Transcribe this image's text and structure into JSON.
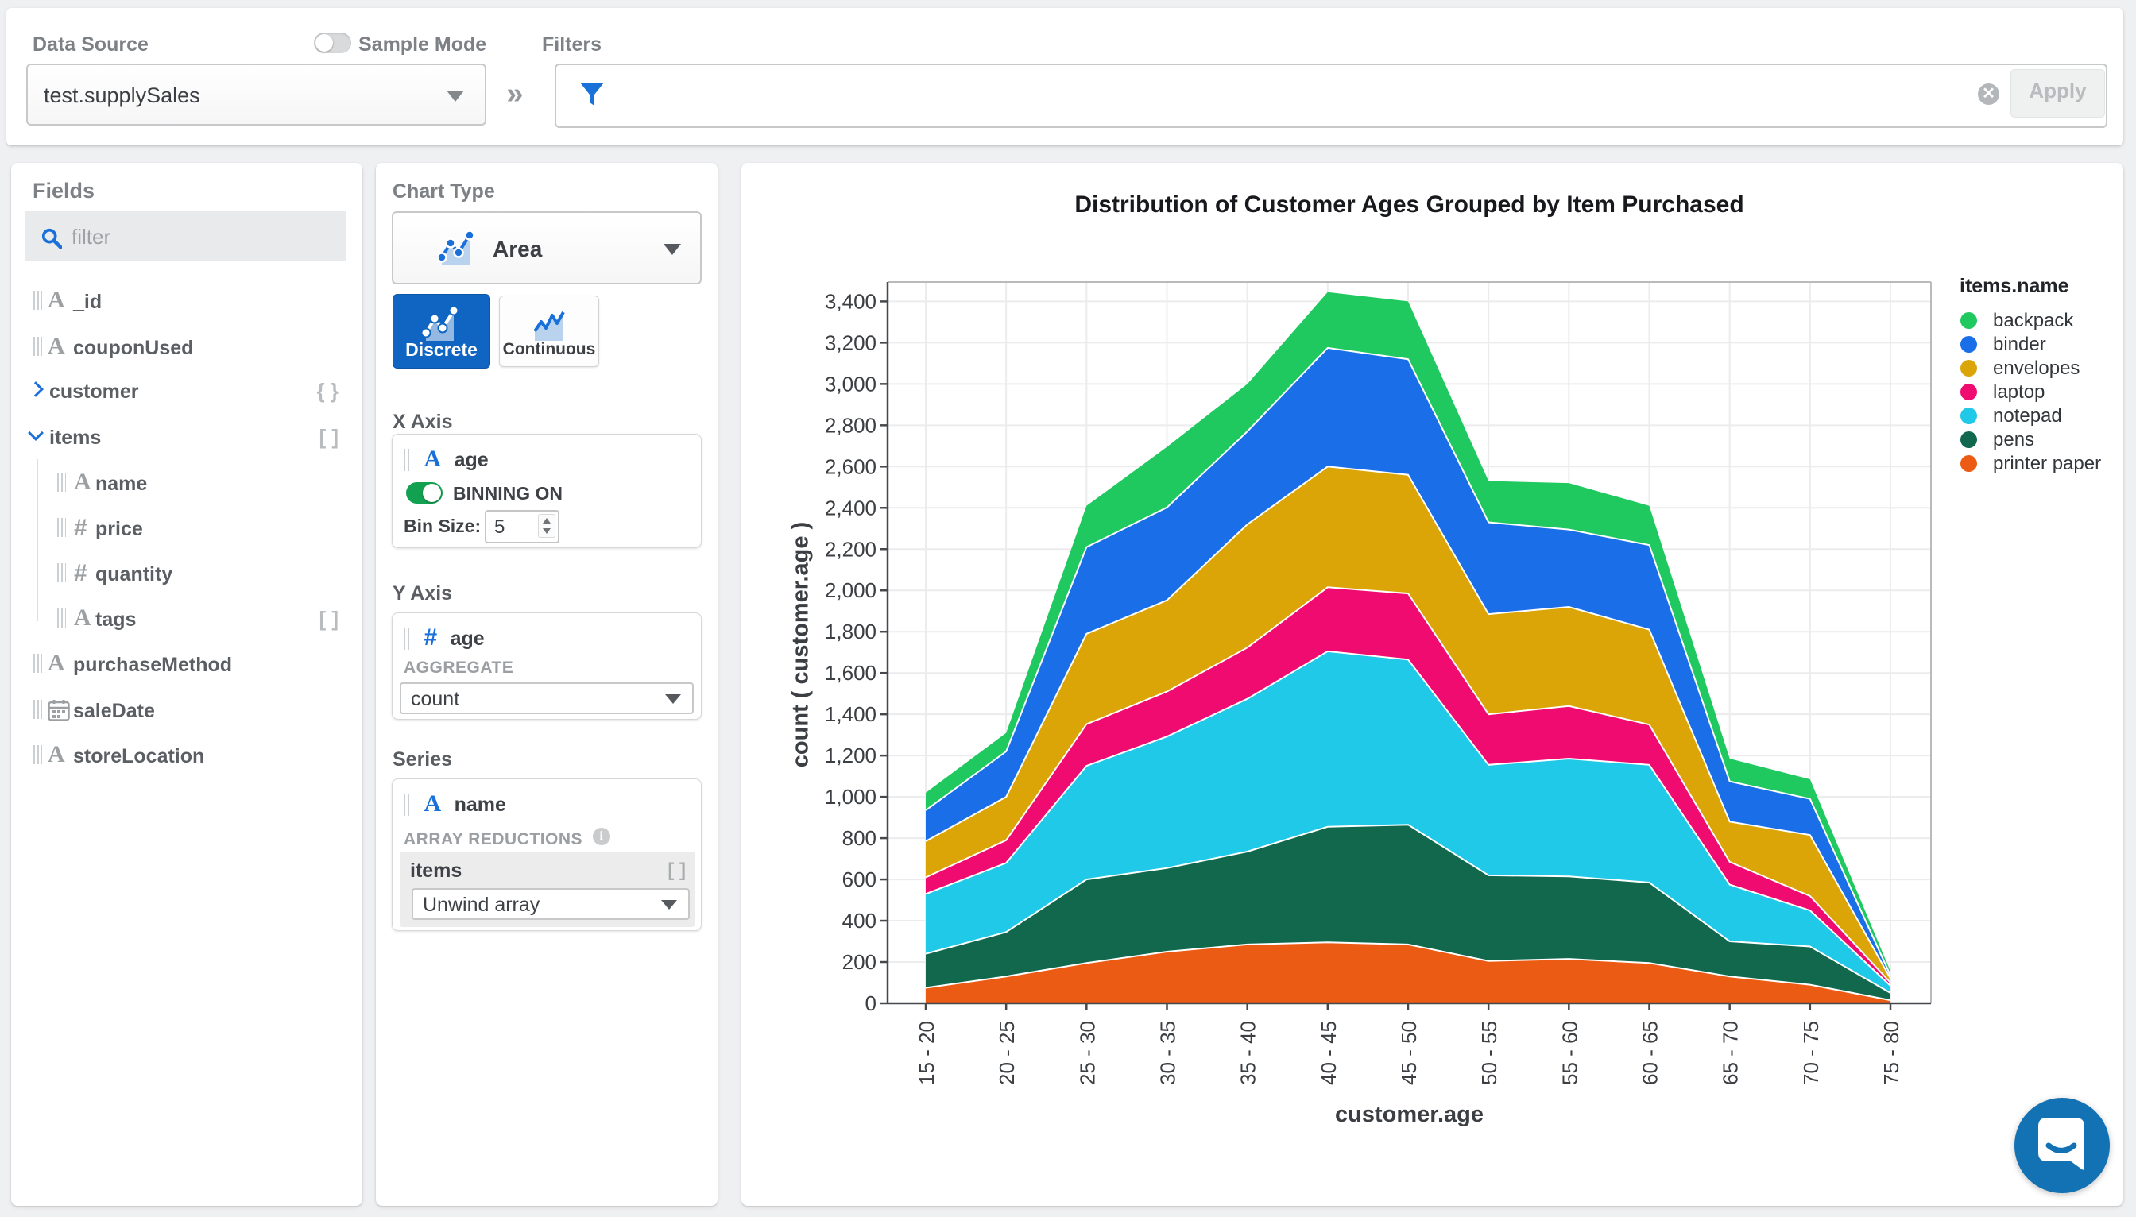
{
  "topbar": {
    "data_source_label": "Data Source",
    "data_source_value": "test.supplySales",
    "sample_mode_label": "Sample Mode",
    "filters_label": "Filters",
    "collapse_icon": "»",
    "clear_icon": "✕",
    "apply_label": "Apply"
  },
  "fields": {
    "title": "Fields",
    "filter_placeholder": "filter",
    "items": [
      {
        "label": "_id",
        "type": "string",
        "level": 0
      },
      {
        "label": "couponUsed",
        "type": "string",
        "level": 0
      },
      {
        "label": "customer",
        "type": "object",
        "level": 0,
        "expandable": true,
        "expanded": false,
        "badge": "{ }"
      },
      {
        "label": "items",
        "type": "array",
        "level": 0,
        "expandable": true,
        "expanded": true,
        "badge": "[ ]"
      },
      {
        "label": "name",
        "type": "string",
        "level": 1
      },
      {
        "label": "price",
        "type": "number",
        "level": 1
      },
      {
        "label": "quantity",
        "type": "number",
        "level": 1
      },
      {
        "label": "tags",
        "type": "string",
        "level": 1,
        "badge": "[ ]"
      },
      {
        "label": "purchaseMethod",
        "type": "string",
        "level": 0
      },
      {
        "label": "saleDate",
        "type": "date",
        "level": 0
      },
      {
        "label": "storeLocation",
        "type": "string",
        "level": 0
      }
    ]
  },
  "chart_type": {
    "label": "Chart Type",
    "selected": "Area",
    "discrete_label": "Discrete",
    "continuous_label": "Continuous",
    "discrete_selected": true
  },
  "encoding": {
    "x_axis_label": "X Axis",
    "x_field": "age",
    "x_field_type": "string",
    "binning_label": "BINNING ON",
    "binning_on": true,
    "bin_size_label": "Bin Size:",
    "bin_size_value": "5",
    "y_axis_label": "Y Axis",
    "y_field": "age",
    "y_field_type": "number",
    "aggregate_label": "AGGREGATE",
    "aggregate_value": "count",
    "series_label": "Series",
    "series_field": "name",
    "series_field_type": "string",
    "array_reductions_label": "ARRAY REDUCTIONS",
    "reduction_field": "items",
    "reduction_badge": "[ ]",
    "reduction_value": "Unwind array"
  },
  "chart_data": {
    "type": "area",
    "variant": "stacked-discrete",
    "title": "Distribution of Customer Ages Grouped by Item Purchased",
    "xlabel": "customer.age",
    "ylabel": "count ( customer.age )",
    "legend_title": "items.name",
    "legend_position": "right",
    "grid": true,
    "ylim": [
      0,
      3400
    ],
    "ytick_step": 200,
    "categories": [
      "15 - 20",
      "20 - 25",
      "25 - 30",
      "30 - 35",
      "35 - 40",
      "40 - 45",
      "45 - 50",
      "50 - 55",
      "55 - 60",
      "60 - 65",
      "65 - 70",
      "70 - 75",
      "75 - 80"
    ],
    "series": [
      {
        "name": "backpack",
        "color": "#20c95f",
        "values": [
          85,
          90,
          200,
          293,
          230,
          270,
          280,
          200,
          225,
          190,
          110,
          95,
          20
        ]
      },
      {
        "name": "binder",
        "color": "#1a6fe8",
        "values": [
          150,
          220,
          420,
          450,
          450,
          575,
          560,
          445,
          375,
          410,
          195,
          175,
          15
        ]
      },
      {
        "name": "envelopes",
        "color": "#dba508",
        "values": [
          175,
          210,
          438,
          442,
          597,
          585,
          575,
          485,
          480,
          460,
          195,
          295,
          20
        ]
      },
      {
        "name": "laptop",
        "color": "#ef0b70",
        "values": [
          80,
          110,
          202,
          218,
          248,
          310,
          320,
          245,
          255,
          195,
          110,
          70,
          15
        ]
      },
      {
        "name": "notepad",
        "color": "#20c9e7",
        "values": [
          290,
          335,
          550,
          637,
          740,
          850,
          800,
          535,
          570,
          570,
          275,
          175,
          35
        ]
      },
      {
        "name": "pens",
        "color": "#11684d",
        "values": [
          165,
          215,
          405,
          405,
          450,
          560,
          580,
          415,
          400,
          390,
          170,
          185,
          35
        ]
      },
      {
        "name": "printer paper",
        "color": "#ec5b13",
        "values": [
          75,
          130,
          195,
          250,
          285,
          295,
          285,
          205,
          215,
          195,
          130,
          90,
          15
        ]
      }
    ],
    "stack_order_bottom_to_top": [
      "printer paper",
      "pens",
      "notepad",
      "laptop",
      "envelopes",
      "binder",
      "backpack"
    ]
  },
  "intercom_color": "#1272b3"
}
